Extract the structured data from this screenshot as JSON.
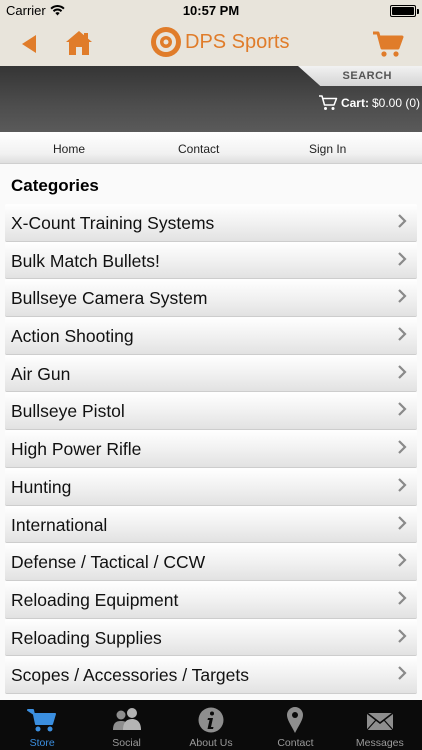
{
  "status_bar": {
    "carrier": "Carrier",
    "time": "10:57 PM"
  },
  "nav": {
    "title": "DPS Sports",
    "accent_color": "#e07c2a",
    "icons": [
      "back-arrow-icon",
      "home-icon",
      "target-logo-icon",
      "cart-icon"
    ]
  },
  "header": {
    "search_label": "SEARCH",
    "cart_label": "Cart:",
    "cart_value": "$0.00 (0)"
  },
  "subnav": {
    "links": [
      {
        "label": "Home"
      },
      {
        "label": "Contact"
      },
      {
        "label": "Sign In"
      }
    ]
  },
  "categories": {
    "heading": "Categories",
    "items": [
      {
        "label": "X-Count Training Systems"
      },
      {
        "label": "Bulk Match Bullets!"
      },
      {
        "label": "Bullseye Camera System"
      },
      {
        "label": "Action Shooting"
      },
      {
        "label": "Air Gun"
      },
      {
        "label": "Bullseye Pistol"
      },
      {
        "label": "High Power Rifle"
      },
      {
        "label": "Hunting"
      },
      {
        "label": "International"
      },
      {
        "label": "Defense / Tactical / CCW"
      },
      {
        "label": "Reloading Equipment"
      },
      {
        "label": "Reloading Supplies"
      },
      {
        "label": "Scopes / Accessories / Targets"
      }
    ]
  },
  "tabbar": {
    "active_color": "#3b8fe0",
    "tabs": [
      {
        "label": "Store",
        "icon": "cart-icon",
        "active": true
      },
      {
        "label": "Social",
        "icon": "people-icon",
        "active": false
      },
      {
        "label": "About Us",
        "icon": "info-icon",
        "active": false
      },
      {
        "label": "Contact",
        "icon": "map-pin-icon",
        "active": false
      },
      {
        "label": "Messages",
        "icon": "envelope-icon",
        "active": false
      }
    ]
  }
}
